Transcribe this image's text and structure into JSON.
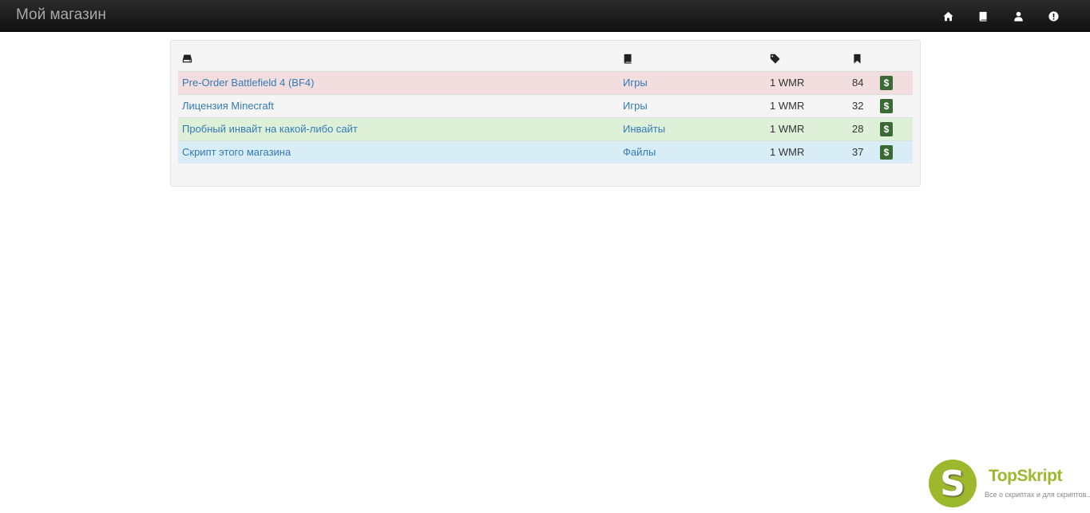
{
  "navbar": {
    "brand": "Мой магазин",
    "icons": [
      "home-icon",
      "book-icon",
      "user-icon",
      "exclamation-icon"
    ]
  },
  "table": {
    "headers": [
      {
        "icon": "hdd-icon"
      },
      {
        "icon": "book-icon"
      },
      {
        "icon": "tag-icon"
      },
      {
        "icon": "bookmark-icon"
      },
      {
        "icon": ""
      }
    ],
    "rows": [
      {
        "name": "Pre-Order Battlefield 4 (BF4)",
        "category": "Игры",
        "price": "1 WMR",
        "count": "84",
        "buy": "$",
        "style": "danger"
      },
      {
        "name": "Лицензия Minecraft",
        "category": "Игры",
        "price": "1 WMR",
        "count": "32",
        "buy": "$",
        "style": "default"
      },
      {
        "name": "Пробный инвайт на какой-либо сайт",
        "category": "Инвайты",
        "price": "1 WMR",
        "count": "28",
        "buy": "$",
        "style": "success"
      },
      {
        "name": "Скрипт этого магазина",
        "category": "Файлы",
        "price": "1 WMR",
        "count": "37",
        "buy": "$",
        "style": "info"
      }
    ]
  },
  "watermark": {
    "letter": "S",
    "name": "TopSkript",
    "tagline": "Все о скриптах и для скриптов..."
  },
  "colors": {
    "navbar": "#1b1b1b",
    "link": "#337ab7",
    "danger_row": "#f2dede",
    "success_row": "#dff0d8",
    "info_row": "#d9edf7",
    "buy_button": "#3a6b35",
    "logo_green": "#9cb82c"
  }
}
